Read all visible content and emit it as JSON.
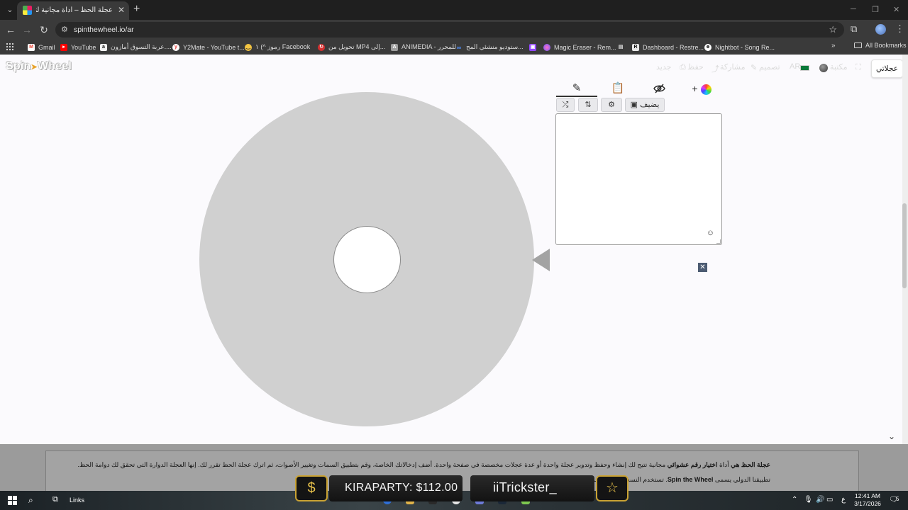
{
  "browser": {
    "tab_title": "عجلة الحظ – أداة مجانية لتدوير ال...",
    "url": "spinthewheel.io/ar",
    "bookmarks": [
      {
        "label": "Gmail",
        "icon": "gmail-icon",
        "color": "#ea4335"
      },
      {
        "label": "YouTube",
        "icon": "youtube-icon",
        "color": "#ff0000"
      },
      {
        "label": "عربة التسوق أمازون....",
        "icon": "amazon-icon",
        "color": "#f3f3f3"
      },
      {
        "label": "Y2Mate - YouTube t...",
        "icon": "y2mate-icon",
        "color": "#e53935"
      },
      {
        "label": "رموز ^) ١ Facebook",
        "icon": "emoji-icon",
        "color": "#f4c542"
      },
      {
        "label": "تحويل من MP4 إلى...",
        "icon": "convert-icon",
        "color": "#d32f2f"
      },
      {
        "label": "ANIMEDIA - للمحرر",
        "icon": "animedia-icon",
        "color": "#9e9e9e"
      },
      {
        "label": "ستوديو منشئي المح...",
        "icon": "meta-icon",
        "color": "#1877f2"
      },
      {
        "label": "Magic Eraser - Rem...",
        "icon": "twitch-icon",
        "color": "#9146ff"
      },
      {
        "label": "Dashboard - Restre...",
        "icon": "restream-icon",
        "color": "#e8e8e8"
      },
      {
        "label": "Nightbot - Song Re...",
        "icon": "nightbot-icon",
        "color": "#ffffff"
      }
    ],
    "all_bookmarks": "All Bookmarks"
  },
  "site": {
    "logo": "Spin Wheel",
    "logo_left": "Spin",
    "logo_right": "Wheel",
    "nav": {
      "my_wheels": "عجلاتي",
      "gallery": "مكتبة",
      "language": "AR",
      "customize": "تصميم",
      "share": "مشاركة",
      "save": "حفظ",
      "new": "جديد"
    },
    "panel": {
      "add_image_label": "يضيف"
    }
  },
  "description": {
    "line1_bold1": "عجلة الحظ هي",
    "line1_text1": " أداة ",
    "line1_bold2": "اختيار رقم عشوائي",
    "line1_text2": " مجانية تتيح لك إنشاء وحفظ وتدوير عجلة واحدة أو عدة عجلات مخصصة في صفحة واحدة. أضف إدخالاتك الخاصة، وقم بتطبيق السمات وتغيير الأصوات، ثم اترك عجلة الحظ تقرر لك. إنها العجلة الدوارة التي تحقق لك دوامة الحظ.",
    "line2_text1": "تطبيقنا الدولي يسمى ",
    "line2_bold": "Spin the Wheel",
    "line2_text2": ". تستخدم النسخة التركية بجميع نفس الميزات"
  },
  "stream_widget": {
    "donation": "KIRAPARTY: $112.00",
    "follower": "iiTrickster_",
    "accent": "#c9a233"
  },
  "taskbar": {
    "links_label": "Links",
    "lang": "ع",
    "time": "12:41 AM",
    "date": "3/17/2026",
    "notifications": "5"
  },
  "colors": {
    "wheel": "#d0d0d0",
    "pointer": "#a3a3a3",
    "close_box": "#4c5b72"
  }
}
